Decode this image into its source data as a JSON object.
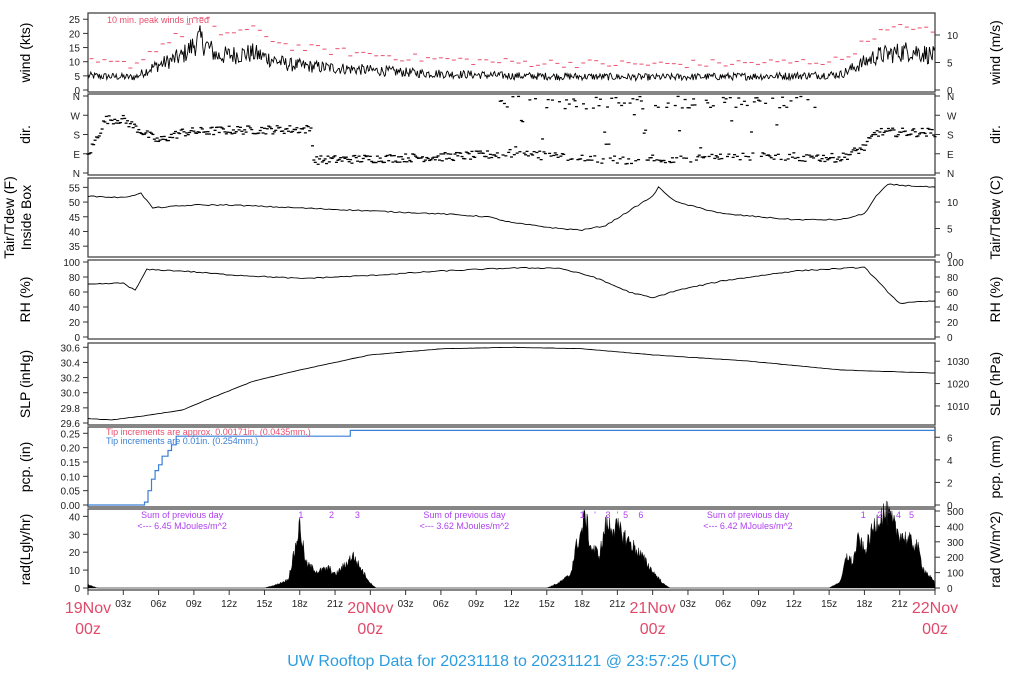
{
  "title": "UW Rooftop Data for 20231118  to  20231121 @ 23:57:25  (UTC)",
  "colors": {
    "peak": "#e8506e",
    "pcp_new": "#3a7fd5",
    "pcp_old": "#e8506e",
    "rad_label": "#b040f0",
    "date": "#e04a6a",
    "title": "#2a9de0"
  },
  "chart_data": {
    "type": "line",
    "x_unit": "hours since 19Nov 00z",
    "xlim": [
      0,
      72
    ],
    "hour_ticks": [
      "03z",
      "06z",
      "09z",
      "12z",
      "15z",
      "18z",
      "21z"
    ],
    "day_labels": [
      {
        "day": "19Nov",
        "hour": "00z",
        "at": 0
      },
      {
        "day": "20Nov",
        "hour": "00z",
        "at": 24
      },
      {
        "day": "21Nov",
        "hour": "00z",
        "at": 48
      },
      {
        "day": "22Nov",
        "hour": "00z",
        "at": 72
      }
    ],
    "panels": {
      "wind": {
        "ylabel": "wind (kts)",
        "ylabel_right": "wind (m/s)",
        "ylim": [
          0,
          26.5
        ],
        "ticks": [
          "0",
          "5",
          "10",
          "15",
          "20",
          "25"
        ],
        "ticks_right": [
          "0",
          "5",
          "10"
        ],
        "annotation": "10 min. peak winds in red",
        "series": [
          [
            0,
            5
          ],
          [
            4,
            4.5
          ],
          [
            5.5,
            8
          ],
          [
            8,
            12
          ],
          [
            9.5,
            18
          ],
          [
            11,
            12
          ],
          [
            14,
            13
          ],
          [
            17,
            9
          ],
          [
            20,
            8
          ],
          [
            28,
            6
          ],
          [
            36,
            5
          ],
          [
            48,
            4.5
          ],
          [
            60,
            5
          ],
          [
            64,
            5.5
          ],
          [
            67,
            12
          ],
          [
            70,
            14
          ],
          [
            72,
            12
          ]
        ]
      },
      "dir": {
        "ylabel": "dir.",
        "ylabel_right": "dir.",
        "ylim": [
          0,
          360
        ],
        "ticks": [
          "N",
          "E",
          "S",
          "W",
          "N"
        ],
        "series": [
          [
            0,
            80
          ],
          [
            1.5,
            250
          ],
          [
            3,
            250
          ],
          [
            5,
            180
          ],
          [
            6,
            150
          ],
          [
            8,
            190
          ],
          [
            12,
            200
          ],
          [
            19,
            205
          ],
          [
            19.2,
            60
          ],
          [
            30,
            75
          ],
          [
            36,
            90
          ],
          [
            45,
            60
          ],
          [
            56,
            80
          ],
          [
            64,
            70
          ],
          [
            66,
            120
          ],
          [
            67,
            190
          ],
          [
            72,
            190
          ]
        ]
      },
      "temp": {
        "ylabel": "Tair/Tdew (F)",
        "ylabel2": "Inside Box",
        "ylabel_right": "Tair/Tdew (C)",
        "ylim": [
          32,
          57.5
        ],
        "ticks": [
          "35",
          "40",
          "45",
          "50",
          "55"
        ],
        "ticks_right": [
          "0",
          "5",
          "10"
        ],
        "series": [
          [
            0,
            52
          ],
          [
            3,
            51.5
          ],
          [
            4.5,
            53
          ],
          [
            5.5,
            48
          ],
          [
            9,
            49
          ],
          [
            12,
            49
          ],
          [
            18,
            48
          ],
          [
            24,
            47
          ],
          [
            30,
            46
          ],
          [
            34,
            45
          ],
          [
            36,
            43
          ],
          [
            40,
            41
          ],
          [
            42,
            40.5
          ],
          [
            44,
            42
          ],
          [
            46,
            47
          ],
          [
            48,
            52
          ],
          [
            48.5,
            55
          ],
          [
            50,
            50
          ],
          [
            54,
            46
          ],
          [
            60,
            44
          ],
          [
            64,
            44
          ],
          [
            66,
            46
          ],
          [
            67,
            52
          ],
          [
            68,
            56
          ],
          [
            72,
            55
          ]
        ]
      },
      "rh": {
        "ylabel": "RH (%)",
        "ylabel_right": "RH (%)",
        "ylim": [
          0,
          100
        ],
        "ticks": [
          "0",
          "20",
          "40",
          "60",
          "80",
          "100"
        ],
        "series": [
          [
            0,
            70
          ],
          [
            3,
            72
          ],
          [
            4,
            62
          ],
          [
            5,
            90
          ],
          [
            8,
            88
          ],
          [
            12,
            83
          ],
          [
            18,
            78
          ],
          [
            24,
            82
          ],
          [
            30,
            88
          ],
          [
            36,
            92
          ],
          [
            40,
            92
          ],
          [
            43,
            80
          ],
          [
            46,
            60
          ],
          [
            48,
            52
          ],
          [
            50,
            62
          ],
          [
            54,
            75
          ],
          [
            60,
            88
          ],
          [
            66,
            93
          ],
          [
            68,
            60
          ],
          [
            69,
            45
          ],
          [
            72,
            48
          ]
        ]
      },
      "slp": {
        "ylabel": "SLP (inHg)",
        "ylabel_right": "SLP (hPa)",
        "ylim": [
          29.6,
          30.63
        ],
        "ticks": [
          "29.6",
          "29.8",
          "30.0",
          "30.2",
          "30.4",
          "30.6"
        ],
        "ticks_right": [
          "1010",
          "1020",
          "1030"
        ],
        "series": [
          [
            0,
            29.66
          ],
          [
            2,
            29.64
          ],
          [
            5,
            29.7
          ],
          [
            8,
            29.77
          ],
          [
            10,
            29.9
          ],
          [
            14,
            30.15
          ],
          [
            18,
            30.3
          ],
          [
            24,
            30.5
          ],
          [
            30,
            30.58
          ],
          [
            36,
            30.6
          ],
          [
            42,
            30.58
          ],
          [
            48,
            30.5
          ],
          [
            56,
            30.42
          ],
          [
            64,
            30.3
          ],
          [
            72,
            30.26
          ]
        ]
      },
      "pcp": {
        "ylabel": "pcp. (in)",
        "ylabel_right": "pcp. (mm)",
        "ylim": [
          0,
          0.265
        ],
        "ticks": [
          "0.00",
          "0.05",
          "0.10",
          "0.15",
          "0.20",
          "0.25"
        ],
        "ticks_right": [
          "0",
          "2",
          "4",
          "6"
        ],
        "note_old": "Tip increments are approx. 0.00171in. (0.0435mm.)",
        "note_new": "Tip increments are 0.01in. (0.254mm.)",
        "series": [
          [
            0,
            0
          ],
          [
            4.7,
            0
          ],
          [
            4.8,
            0.01
          ],
          [
            5.1,
            0.05
          ],
          [
            5.4,
            0.09
          ],
          [
            5.7,
            0.12
          ],
          [
            6.0,
            0.14
          ],
          [
            6.3,
            0.17
          ],
          [
            6.8,
            0.19
          ],
          [
            7.1,
            0.21
          ],
          [
            7.5,
            0.24
          ],
          [
            22.2,
            0.24
          ],
          [
            22.3,
            0.26
          ],
          [
            72,
            0.26
          ]
        ]
      },
      "rad": {
        "ylabel": "rad(Lgly/hr)",
        "ylabel_right": "rad (W/m^2)",
        "ylim": [
          0,
          43
        ],
        "ticks": [
          "0",
          "10",
          "20",
          "30",
          "40"
        ],
        "ticks_right": [
          "0",
          "100",
          "200",
          "300",
          "400",
          "500"
        ],
        "series": [
          [
            0,
            2
          ],
          [
            0.8,
            0
          ],
          [
            15,
            0
          ],
          [
            16,
            2
          ],
          [
            17,
            5
          ],
          [
            17.5,
            20
          ],
          [
            18,
            38
          ],
          [
            18.5,
            15
          ],
          [
            19.5,
            10
          ],
          [
            20.5,
            12
          ],
          [
            21,
            8
          ],
          [
            22,
            15
          ],
          [
            22.5,
            20
          ],
          [
            23,
            14
          ],
          [
            24,
            3
          ],
          [
            24.5,
            0
          ],
          [
            39,
            0
          ],
          [
            40,
            3
          ],
          [
            41,
            8
          ],
          [
            41.5,
            25
          ],
          [
            42,
            35
          ],
          [
            42.3,
            45
          ],
          [
            42.7,
            25
          ],
          [
            43.5,
            20
          ],
          [
            44,
            38
          ],
          [
            45,
            36
          ],
          [
            46,
            28
          ],
          [
            47,
            20
          ],
          [
            48,
            10
          ],
          [
            49,
            2
          ],
          [
            49.5,
            0
          ],
          [
            63,
            0
          ],
          [
            64,
            4
          ],
          [
            64.5,
            20
          ],
          [
            65,
            15
          ],
          [
            65.5,
            30
          ],
          [
            66,
            22
          ],
          [
            67,
            40
          ],
          [
            67.5,
            45
          ],
          [
            68,
            44
          ],
          [
            68.7,
            35
          ],
          [
            69.5,
            30
          ],
          [
            70.5,
            25
          ],
          [
            71,
            12
          ],
          [
            72,
            3
          ]
        ],
        "daily": [
          {
            "at": 8,
            "line1": "Sum of previous day",
            "line2": "<--- 6.45 MJoules/m^2",
            "marks": [
              {
                "t": "1",
                "at": 18.1
              },
              {
                "t": "2",
                "at": 20.7
              },
              {
                "t": "3",
                "at": 22.9
              }
            ]
          },
          {
            "at": 32,
            "line1": "Sum of previous day",
            "line2": "<--- 3.62 MJoules/m^2",
            "marks": [
              {
                "t": "1",
                "at": 42
              },
              {
                "t": "'",
                "at": 43.1
              },
              {
                "t": "3",
                "at": 44.2
              },
              {
                "t": "'",
                "at": 45
              },
              {
                "t": "5",
                "at": 45.7
              },
              {
                "t": "6",
                "at": 47
              }
            ]
          },
          {
            "at": 56.1,
            "line1": "Sum of previous day",
            "line2": "<--- 6.42 MJoules/m^2",
            "marks": [
              {
                "t": "1",
                "at": 65.9
              },
              {
                "t": "2",
                "at": 67.3
              },
              {
                "t": "'",
                "at": 68.1
              },
              {
                "t": "4",
                "at": 68.9
              },
              {
                "t": "5",
                "at": 70
              }
            ]
          }
        ]
      }
    }
  }
}
